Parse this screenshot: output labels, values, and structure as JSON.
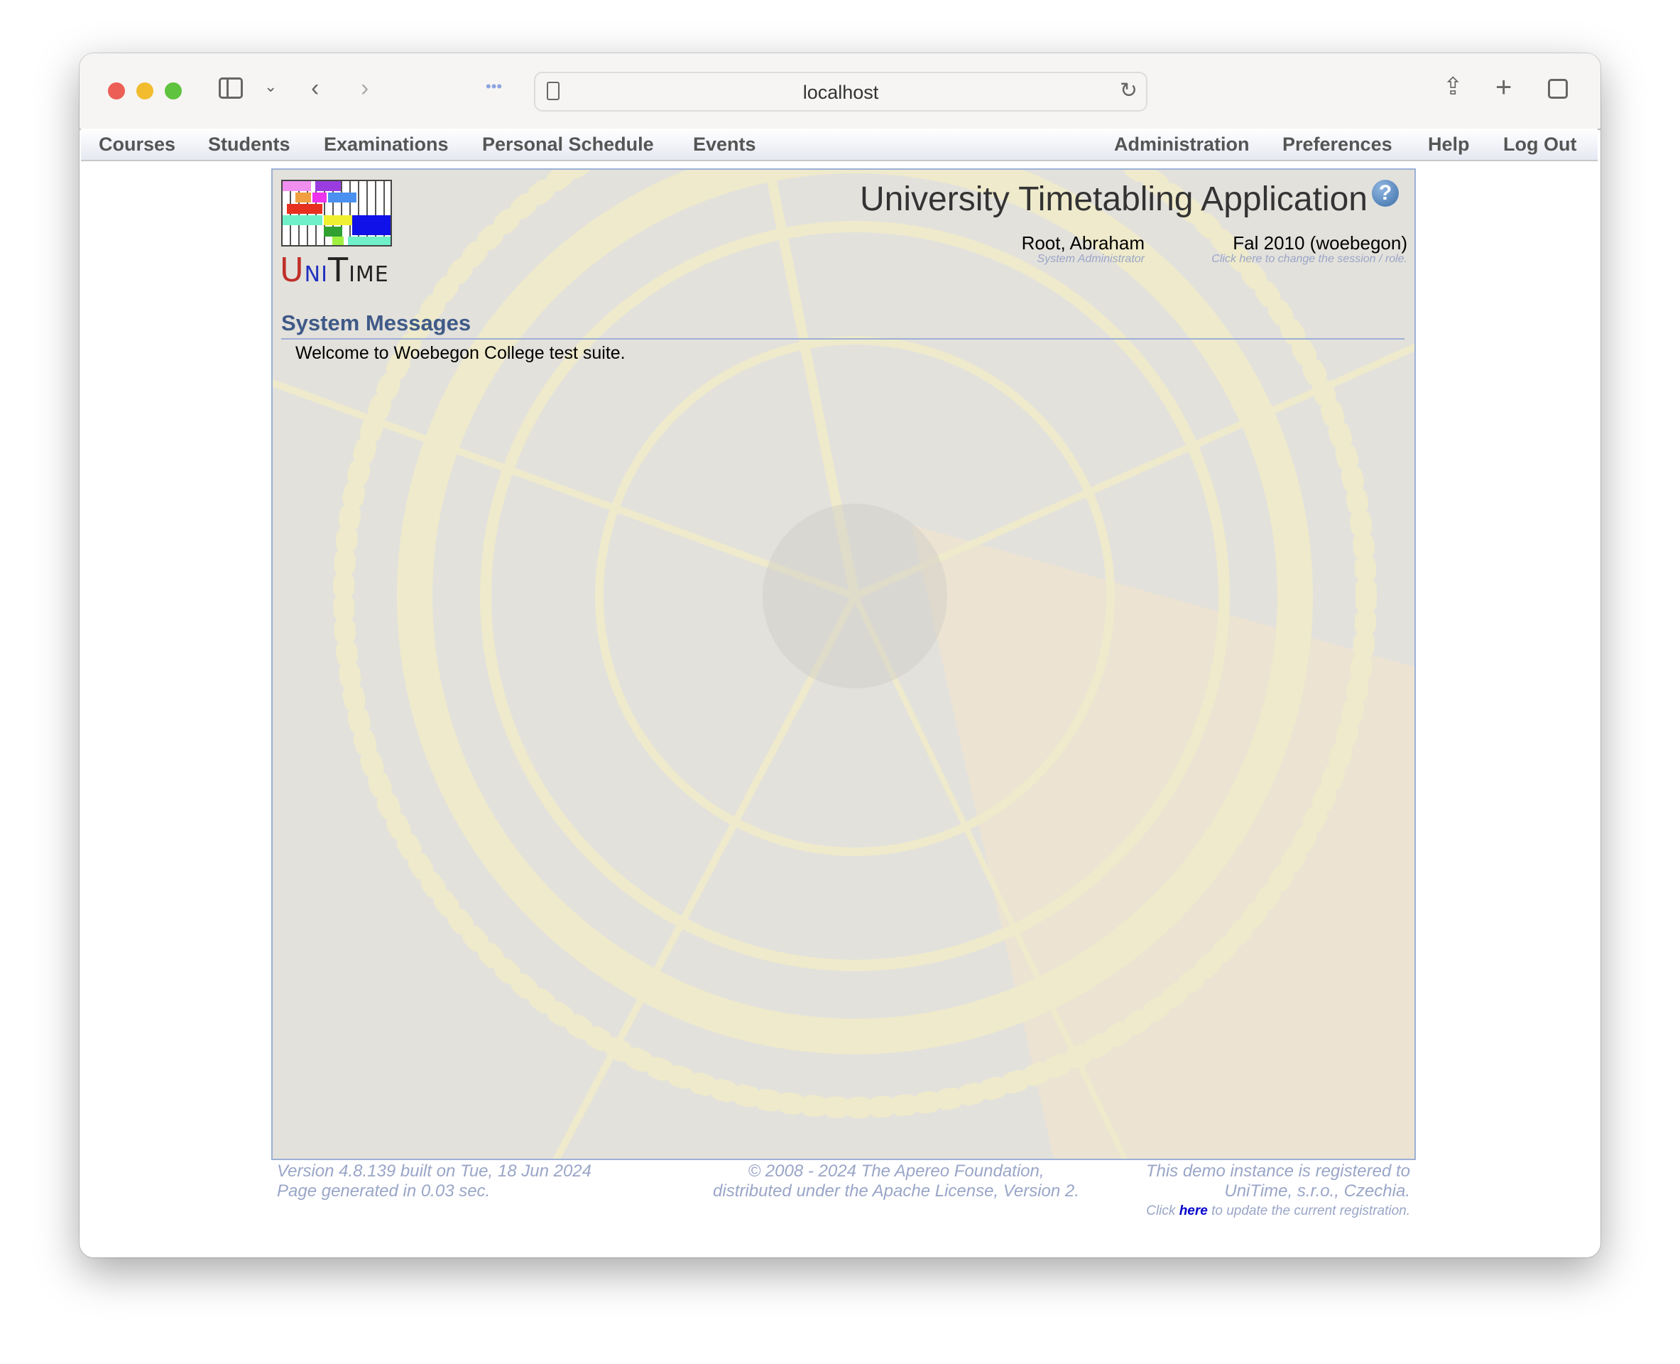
{
  "browser": {
    "url": "localhost",
    "icons": [
      "sidebar-icon",
      "chevron-down-icon",
      "back-icon",
      "forward-icon",
      "extensions-icon",
      "reader-icon",
      "reload-icon",
      "share-icon",
      "new-tab-icon",
      "tabs-overview-icon"
    ]
  },
  "menu": {
    "left": [
      "Courses",
      "Students",
      "Examinations",
      "Personal Schedule",
      "Events"
    ],
    "right": [
      "Administration",
      "Preferences",
      "Help",
      "Log Out"
    ]
  },
  "header": {
    "logo_text": "UniTime",
    "title": "University Timetabling Application",
    "help": "?",
    "user_name": "Root, Abraham",
    "user_role": "System Administrator",
    "session": "Fal 2010 (woebegon)",
    "session_hint": "Click here to change the session / role."
  },
  "messages": {
    "heading": "System Messages",
    "text": "Welcome to Woebegon College test suite."
  },
  "footer": {
    "version": "Version 4.8.139 built on Tue, 18 Jun 2024",
    "generated": "Page generated in 0.03 sec.",
    "copyright": "© 2008 - 2024 The Apereo Foundation,",
    "license": "distributed under the Apache License, Version 2.",
    "reg1": "This demo instance is registered to",
    "reg2": "UniTime, s.r.o., Czechia.",
    "reg3_pre": "Click",
    "reg3_link": "here",
    "reg3_post": "to update the current registration."
  },
  "colors": {
    "accent": "#3f5a87",
    "frame_border": "#9cb0d6",
    "footer_text": "#9aa6c8"
  }
}
